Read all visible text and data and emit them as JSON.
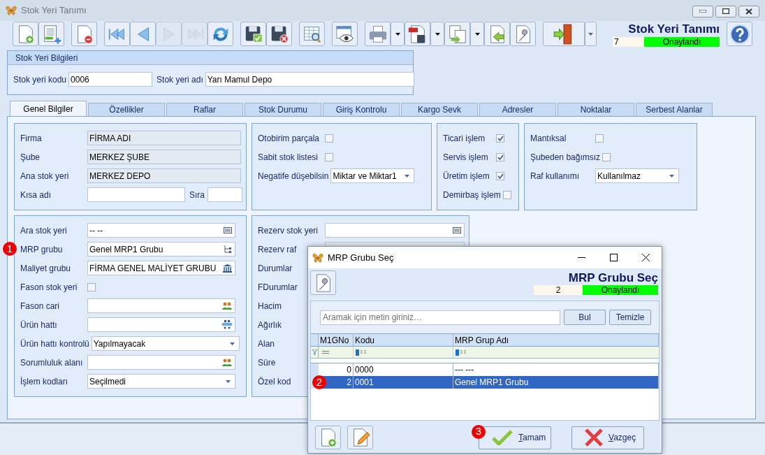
{
  "window": {
    "title": "Stok Yeri Tanımı"
  },
  "toolbar": [
    {
      "buttons": [
        {
          "kind": "new-document",
          "dropdown": false,
          "disabled": false
        },
        {
          "kind": "new-list",
          "dropdown": false,
          "disabled": false
        }
      ]
    },
    {
      "buttons": [
        {
          "kind": "delete-document",
          "dropdown": false,
          "disabled": false
        }
      ]
    },
    {
      "buttons": [
        {
          "kind": "first",
          "dropdown": false,
          "disabled": false
        },
        {
          "kind": "previous",
          "dropdown": false,
          "disabled": false
        },
        {
          "kind": "next",
          "dropdown": false,
          "disabled": true
        },
        {
          "kind": "last",
          "dropdown": false,
          "disabled": true
        },
        {
          "kind": "refresh",
          "dropdown": false,
          "disabled": false
        }
      ]
    },
    {
      "buttons": [
        {
          "kind": "save-confirm",
          "dropdown": false,
          "disabled": false
        },
        {
          "kind": "save-cancel",
          "dropdown": false,
          "disabled": false
        }
      ]
    },
    {
      "buttons": [
        {
          "kind": "table-search",
          "dropdown": false,
          "disabled": false
        }
      ]
    },
    {
      "buttons": [
        {
          "kind": "preview",
          "dropdown": false,
          "disabled": false
        }
      ]
    },
    {
      "buttons": [
        {
          "kind": "print",
          "dropdown": true,
          "disabled": false
        },
        {
          "kind": "pdf",
          "dropdown": true,
          "disabled": false
        },
        {
          "kind": "copy",
          "dropdown": true,
          "disabled": false
        },
        {
          "kind": "import",
          "dropdown": false,
          "disabled": false
        },
        {
          "kind": "settings",
          "dropdown": false,
          "disabled": false
        }
      ]
    },
    {
      "buttons": [
        {
          "kind": "exit",
          "dropdown": true,
          "disabled": false
        }
      ]
    }
  ],
  "header": {
    "title": "Stok Yeri Tanımı",
    "record": "7",
    "status": "Onaylandı"
  },
  "info_group": {
    "title": "Stok Yeri Bilgileri",
    "fields": [
      {
        "label": "Stok yeri kodu",
        "value": "0006"
      },
      {
        "label": "Stok yeri adı",
        "value": "Yarı Mamul Depo"
      }
    ]
  },
  "tabs": [
    {
      "label": "Genel Bilgiler",
      "selected": true
    },
    {
      "label": "Özellikler",
      "selected": false
    },
    {
      "label": "Raflar",
      "selected": false
    },
    {
      "label": "Stok Durumu",
      "selected": false
    },
    {
      "label": "Giriş Kontrolu",
      "selected": false
    },
    {
      "label": "Kargo Sevk",
      "selected": false
    },
    {
      "label": "Adresler",
      "selected": false
    },
    {
      "label": "Noktalar",
      "selected": false
    },
    {
      "label": "Serbest Alanlar",
      "selected": false
    }
  ],
  "groups": [
    {
      "rows": [
        {
          "kind": "readonly",
          "label": "Firma",
          "value": "FİRMA ADI"
        },
        {
          "kind": "readonly",
          "label": "Şube",
          "value": "MERKEZ ŞUBE"
        },
        {
          "kind": "readonly",
          "label": "Ana stok yeri",
          "value": "MERKEZ DEPO"
        },
        {
          "kind": "pair",
          "label": "Kısa adı",
          "label2": "Sıra"
        }
      ]
    },
    {
      "rows": [
        {
          "kind": "checkbox",
          "label": "Otobirim parçala",
          "checked": false
        },
        {
          "kind": "checkbox",
          "label": "Sabit stok listesi",
          "checked": false
        },
        {
          "kind": "select",
          "label": "Negatife düşebilsin",
          "value": "Miktar ve Miktar1"
        }
      ]
    },
    {
      "rows": [
        {
          "kind": "checkbox",
          "label": "Ticari işlem",
          "checked": true
        },
        {
          "kind": "checkbox",
          "label": "Servis işlem",
          "checked": true
        },
        {
          "kind": "checkbox",
          "label": "Üretim işlem",
          "checked": true
        },
        {
          "kind": "checkbox",
          "label": "Demirbaş işlem",
          "checked": false
        }
      ]
    },
    {
      "rows": [
        {
          "kind": "checkbox",
          "label": "Mantıksal",
          "checked": false
        },
        {
          "kind": "checkbox",
          "label": "Şubeden bağımsız",
          "checked": false
        },
        {
          "kind": "select",
          "label": "Raf kullanımı",
          "value": "Kullanılmaz"
        }
      ]
    },
    {
      "rows": [
        {
          "kind": "lookup-code",
          "label": "Ara stok yeri",
          "value": "-- --"
        },
        {
          "kind": "lookup-tree",
          "label": "MRP grubu",
          "value": "Genel MRP1 Grubu",
          "marker": "1"
        },
        {
          "kind": "lookup-bank",
          "label": "Maliyet grubu",
          "value": "FİRMA GENEL MALİYET GRUBU"
        },
        {
          "kind": "checkbox",
          "label": "Fason stok yeri",
          "checked": false
        },
        {
          "kind": "lookup-people",
          "label": "Fason cari"
        },
        {
          "kind": "lookup-line",
          "label": "Ürün hattı"
        },
        {
          "kind": "select",
          "label": "Ürün hattı kontrolü",
          "value": "Yapılmayacak"
        },
        {
          "kind": "lookup-people",
          "label": "Sorumluluk alanı"
        },
        {
          "kind": "select",
          "label": "İşlem kodları",
          "value": "Seçilmedi"
        }
      ]
    },
    {
      "rows": [
        {
          "kind": "lookup-code",
          "label": "Rezerv stok yeri"
        },
        {
          "kind": "disabled",
          "label": "Rezerv raf"
        },
        {
          "kind": "label",
          "label": "Durumlar"
        },
        {
          "kind": "label",
          "label": "FDurumlar"
        },
        {
          "kind": "label",
          "label": "Hacim"
        },
        {
          "kind": "label",
          "label": "Ağırlık"
        },
        {
          "kind": "label",
          "label": "Alan"
        },
        {
          "kind": "label",
          "label": "Süre"
        },
        {
          "kind": "label",
          "label": "Özel kod"
        }
      ]
    }
  ],
  "dialog": {
    "title": "MRP Grubu Seç",
    "heading": "MRP Grubu Seç",
    "record": "2",
    "status": "Onaylandı",
    "search": {
      "placeholder": "Aramak için metin giriniz…"
    },
    "search_buttons": [
      "Bul",
      "Temizle"
    ],
    "columns": [
      "M1GNo",
      "Kodu",
      "MRP Grup Adı"
    ],
    "rows": [
      {
        "cells": [
          "0",
          "0000",
          "--- ---"
        ],
        "selected": false
      },
      {
        "cells": [
          "2",
          "0001",
          "Genel MRP1 Grubu"
        ],
        "selected": true,
        "marker": "2"
      }
    ],
    "ok": {
      "label": "Tamam",
      "marker": "3"
    },
    "cancel": {
      "label": "Vazgeç"
    }
  }
}
